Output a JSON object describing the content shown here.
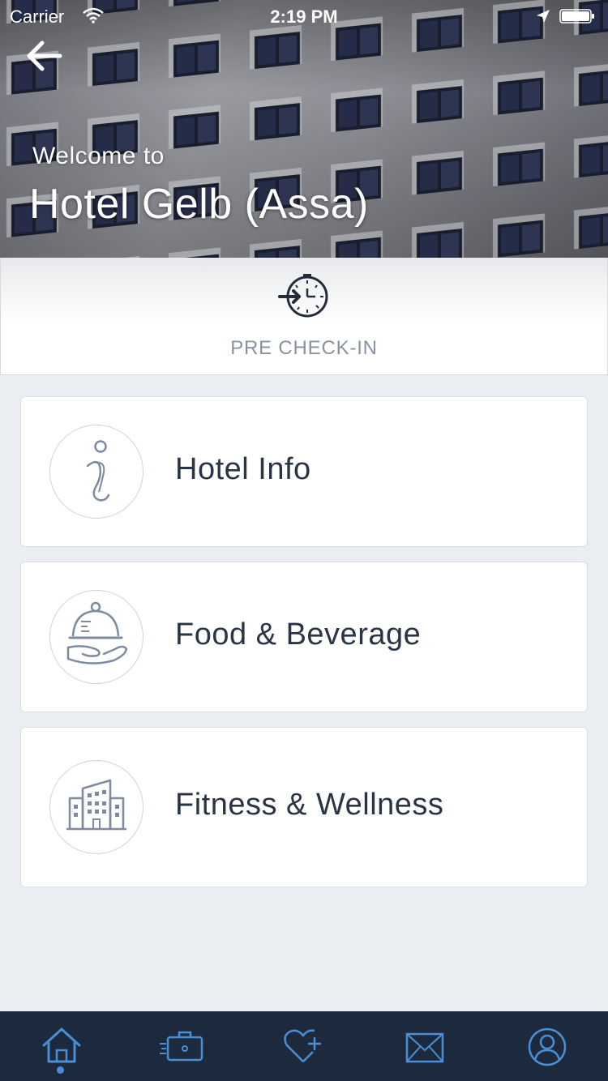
{
  "status_bar": {
    "carrier": "Carrier",
    "time": "2:19 PM"
  },
  "header": {
    "welcome": "Welcome to",
    "hotel_name": "Hotel Gelb (Assa)"
  },
  "precheck": {
    "label": "PRE CHECK-IN",
    "icon": "clock-checkin-icon"
  },
  "cards": [
    {
      "title": "Hotel Info",
      "icon": "info-icon"
    },
    {
      "title": "Food & Beverage",
      "icon": "cloche-icon"
    },
    {
      "title": "Fitness & Wellness",
      "icon": "building-icon"
    }
  ],
  "tabbar": {
    "items": [
      {
        "icon": "home-icon",
        "active": true
      },
      {
        "icon": "luggage-icon",
        "active": false
      },
      {
        "icon": "heart-plus-icon",
        "active": false
      },
      {
        "icon": "mail-icon",
        "active": false
      },
      {
        "icon": "profile-icon",
        "active": false
      }
    ]
  },
  "colors": {
    "tab_bar": "#1d2a3e",
    "tab_icon": "#4a8fd6",
    "card_text": "#2b3444",
    "precheck_text": "#8792a3"
  }
}
